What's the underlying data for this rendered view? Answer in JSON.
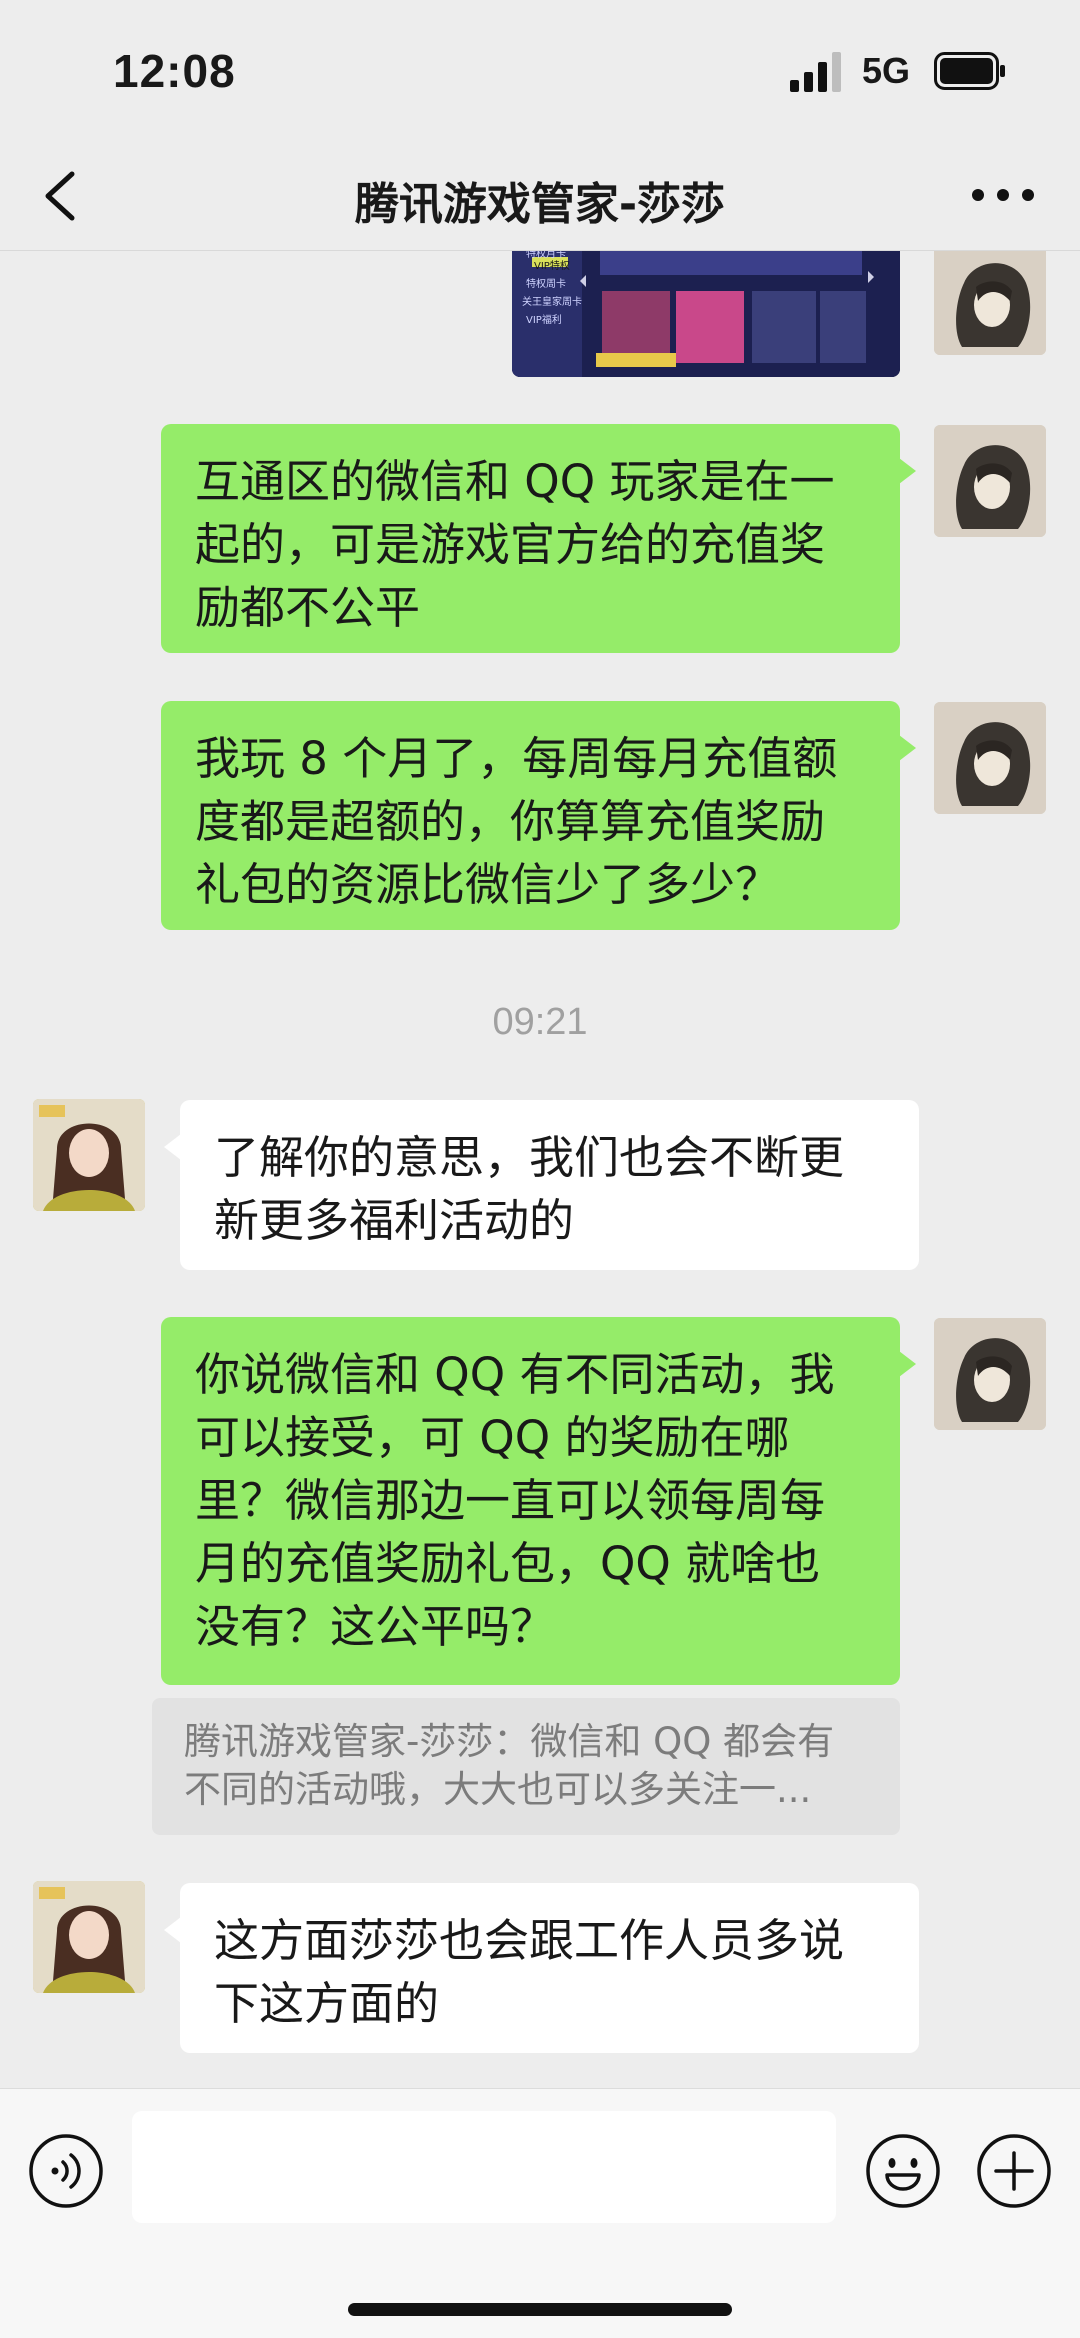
{
  "status_bar": {
    "time": "12:08",
    "network": "5G"
  },
  "navbar": {
    "title": "腾讯游戏管家-莎莎",
    "back_icon": "chevron-left-icon",
    "more_icon": "ellipsis-icon"
  },
  "messages": [
    {
      "sender": "me",
      "type": "image",
      "preview_labels": [
        "特权月卡",
        "VIP特权",
        "特权周卡",
        "关王皇家周卡",
        "VIP福利"
      ]
    },
    {
      "sender": "me",
      "type": "text",
      "lines": [
        "互通区的微信和 QQ 玩家是在一",
        "起的，可是游戏官方给的充值奖",
        "励都不公平"
      ]
    },
    {
      "sender": "me",
      "type": "text",
      "lines": [
        "我玩 8 个月了，每周每月充值额",
        "度都是超额的，你算算充值奖励",
        "礼包的资源比微信少了多少？"
      ]
    },
    {
      "type": "timestamp",
      "text": "09:21"
    },
    {
      "sender": "her",
      "type": "text",
      "lines": [
        "了解你的意思，我们也会不断更",
        "新更多福利活动的"
      ]
    },
    {
      "sender": "me",
      "type": "text",
      "lines": [
        "你说微信和 QQ 有不同活动，我",
        "可以接受，可 QQ 的奖励在哪",
        "里？微信那边一直可以领每周每",
        "月的充值奖励礼包，QQ 就啥也",
        "没有？这公平吗？"
      ]
    },
    {
      "type": "quote",
      "lines": [
        "腾讯游戏管家-莎莎：微信和 QQ 都会有",
        "不同的活动哦，大大也可以多关注一..."
      ]
    },
    {
      "sender": "her",
      "type": "text",
      "lines": [
        "这方面莎莎也会跟工作人员多说",
        "下这方面的"
      ]
    }
  ],
  "input_bar": {
    "placeholder": "",
    "voice_icon": "voice-icon",
    "emoji_icon": "emoji-icon",
    "plus_icon": "plus-icon"
  },
  "colors": {
    "my_bubble": "#95ec69",
    "her_bubble": "#ffffff",
    "background": "#ededed"
  }
}
